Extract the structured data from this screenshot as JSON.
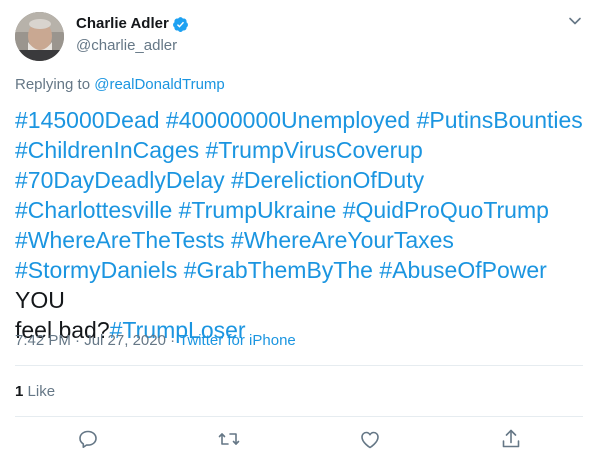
{
  "author": {
    "display_name": "Charlie Adler",
    "handle": "@charlie_adler",
    "verified": true
  },
  "reply": {
    "prefix": "Replying to",
    "mention": "@realDonaldTrump"
  },
  "body": {
    "line1": [
      "#145000Dead",
      "#40000000Unemployed",
      "#PutinsBounties"
    ],
    "line2": [
      "#ChildrenInCages",
      "#TrumpVirusCoverup"
    ],
    "line3": [
      "#70DayDeadlyDelay",
      "#DerelictionOfDuty"
    ],
    "line4": [
      "#Charlottesville",
      "#TrumpUkraine",
      "#QuidProQuoTrump"
    ],
    "line5": [
      "#WhereAreTheTests",
      "#WhereAreYourTaxes"
    ],
    "line6": [
      "#StormyDaniels",
      "#GrabThemByThe",
      "#AbuseOfPower"
    ],
    "plain_tail": "YOU",
    "line7_plain": "feel bad?",
    "line7_tag": "#TrumpLoser"
  },
  "meta": {
    "time": "7:42 PM",
    "date": "Jul 27, 2020",
    "separator": "·",
    "source": "Twitter for iPhone"
  },
  "stats": {
    "like_count": "1",
    "like_label": "Like"
  },
  "colors": {
    "link": "#1b95e0",
    "text": "#14171a",
    "muted": "#657786",
    "divider": "#e6ecf0",
    "verified": "#1da1f2"
  },
  "icons": {
    "reply": "reply-icon",
    "retweet": "retweet-icon",
    "like": "like-icon",
    "share": "share-icon",
    "caret": "chevron-down-icon",
    "verified": "verified-badge-icon"
  }
}
